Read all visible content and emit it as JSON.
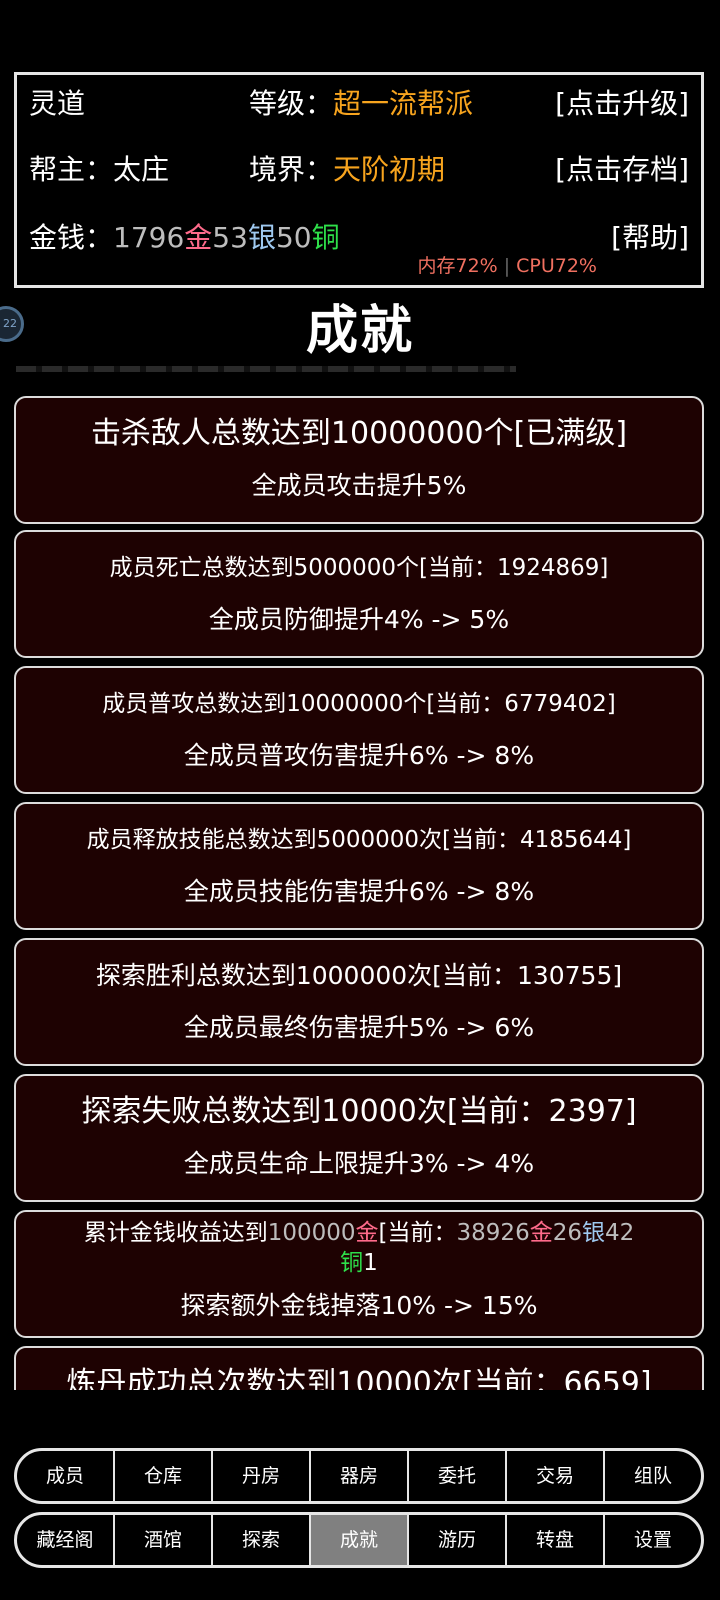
{
  "header": {
    "guild_name": "灵道",
    "level_label": "等级：",
    "level_value": "超一流帮派",
    "upgrade_button": "[点击升级]",
    "leader_label": "帮主：",
    "leader_name": "太庄",
    "realm_label": "境界：",
    "realm_value": "天阶初期",
    "save_button": "[点击存档]",
    "money_label": "金钱：",
    "gold_amount": "1796",
    "gold_unit": "金",
    "silver_amount": "53",
    "silver_unit": "银",
    "copper_amount": "50",
    "copper_unit": "铜",
    "help_button": "[帮助]",
    "memory_stat": "内存72%",
    "cpu_stat": "CPU72%"
  },
  "float_badge": "22",
  "page_title": "成就",
  "achievements": [
    {
      "title": "击杀敌人总数达到10000000个[已满级]",
      "desc": "全成员攻击提升5%"
    },
    {
      "title": "成员死亡总数达到5000000个[当前：1924869]",
      "desc": "全成员防御提升4% -> 5%"
    },
    {
      "title": "成员普攻总数达到10000000个[当前：6779402]",
      "desc": "全成员普攻伤害提升6% -> 8%"
    },
    {
      "title": "成员释放技能总数达到5000000次[当前：4185644]",
      "desc": "全成员技能伤害提升6% -> 8%"
    },
    {
      "title": "探索胜利总数达到1000000次[当前：130755]",
      "desc": "全成员最终伤害提升5% -> 6%"
    },
    {
      "title": "探索失败总数达到10000次[当前：2397]",
      "desc": "全成员生命上限提升3% -> 4%"
    },
    {
      "title_prefix": "累计金钱收益达到",
      "target_amount": "100000",
      "target_unit": "金",
      "current_prefix": "[当前：",
      "cur_gold": "38926",
      "cur_gold_unit": "金",
      "cur_silver": "26",
      "cur_silver_unit": "银",
      "cur_copper": "42",
      "cur_copper_unit": "铜",
      "cur_suffix": "1",
      "desc": "探索额外金钱掉落10% -> 15%"
    },
    {
      "title": "炼丹成功总次数达到10000次[当前：6659]",
      "desc": ""
    }
  ],
  "nav_row1": [
    "成员",
    "仓库",
    "丹房",
    "器房",
    "委托",
    "交易",
    "组队"
  ],
  "nav_row2": [
    "藏经阁",
    "酒馆",
    "探索",
    "成就",
    "游历",
    "转盘",
    "设置"
  ],
  "active_tab": "成就"
}
